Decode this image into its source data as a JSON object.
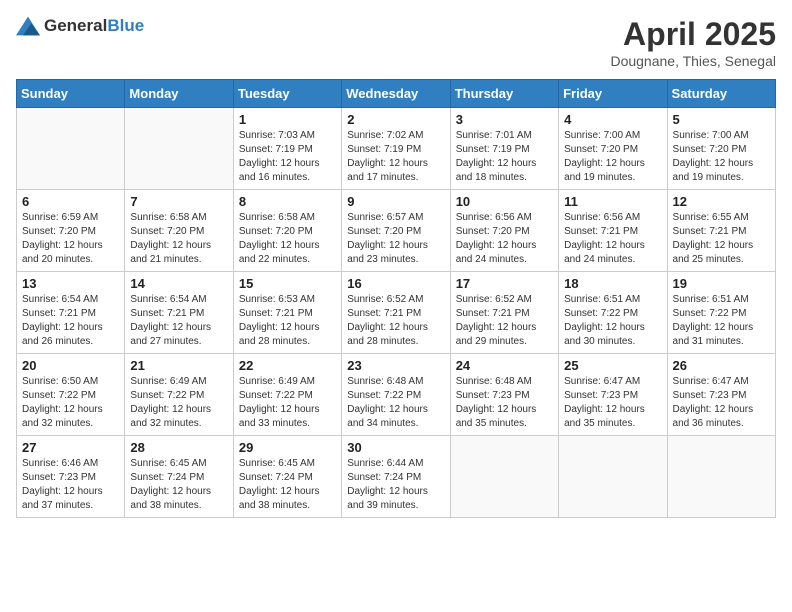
{
  "header": {
    "logo_general": "General",
    "logo_blue": "Blue",
    "month": "April 2025",
    "location": "Dougnane, Thies, Senegal"
  },
  "days_of_week": [
    "Sunday",
    "Monday",
    "Tuesday",
    "Wednesday",
    "Thursday",
    "Friday",
    "Saturday"
  ],
  "weeks": [
    [
      {
        "day": "",
        "sunrise": "",
        "sunset": "",
        "daylight": "",
        "empty": true
      },
      {
        "day": "",
        "sunrise": "",
        "sunset": "",
        "daylight": "",
        "empty": true
      },
      {
        "day": "1",
        "sunrise": "Sunrise: 7:03 AM",
        "sunset": "Sunset: 7:19 PM",
        "daylight": "Daylight: 12 hours and 16 minutes.",
        "empty": false
      },
      {
        "day": "2",
        "sunrise": "Sunrise: 7:02 AM",
        "sunset": "Sunset: 7:19 PM",
        "daylight": "Daylight: 12 hours and 17 minutes.",
        "empty": false
      },
      {
        "day": "3",
        "sunrise": "Sunrise: 7:01 AM",
        "sunset": "Sunset: 7:19 PM",
        "daylight": "Daylight: 12 hours and 18 minutes.",
        "empty": false
      },
      {
        "day": "4",
        "sunrise": "Sunrise: 7:00 AM",
        "sunset": "Sunset: 7:20 PM",
        "daylight": "Daylight: 12 hours and 19 minutes.",
        "empty": false
      },
      {
        "day": "5",
        "sunrise": "Sunrise: 7:00 AM",
        "sunset": "Sunset: 7:20 PM",
        "daylight": "Daylight: 12 hours and 19 minutes.",
        "empty": false
      }
    ],
    [
      {
        "day": "6",
        "sunrise": "Sunrise: 6:59 AM",
        "sunset": "Sunset: 7:20 PM",
        "daylight": "Daylight: 12 hours and 20 minutes.",
        "empty": false
      },
      {
        "day": "7",
        "sunrise": "Sunrise: 6:58 AM",
        "sunset": "Sunset: 7:20 PM",
        "daylight": "Daylight: 12 hours and 21 minutes.",
        "empty": false
      },
      {
        "day": "8",
        "sunrise": "Sunrise: 6:58 AM",
        "sunset": "Sunset: 7:20 PM",
        "daylight": "Daylight: 12 hours and 22 minutes.",
        "empty": false
      },
      {
        "day": "9",
        "sunrise": "Sunrise: 6:57 AM",
        "sunset": "Sunset: 7:20 PM",
        "daylight": "Daylight: 12 hours and 23 minutes.",
        "empty": false
      },
      {
        "day": "10",
        "sunrise": "Sunrise: 6:56 AM",
        "sunset": "Sunset: 7:20 PM",
        "daylight": "Daylight: 12 hours and 24 minutes.",
        "empty": false
      },
      {
        "day": "11",
        "sunrise": "Sunrise: 6:56 AM",
        "sunset": "Sunset: 7:21 PM",
        "daylight": "Daylight: 12 hours and 24 minutes.",
        "empty": false
      },
      {
        "day": "12",
        "sunrise": "Sunrise: 6:55 AM",
        "sunset": "Sunset: 7:21 PM",
        "daylight": "Daylight: 12 hours and 25 minutes.",
        "empty": false
      }
    ],
    [
      {
        "day": "13",
        "sunrise": "Sunrise: 6:54 AM",
        "sunset": "Sunset: 7:21 PM",
        "daylight": "Daylight: 12 hours and 26 minutes.",
        "empty": false
      },
      {
        "day": "14",
        "sunrise": "Sunrise: 6:54 AM",
        "sunset": "Sunset: 7:21 PM",
        "daylight": "Daylight: 12 hours and 27 minutes.",
        "empty": false
      },
      {
        "day": "15",
        "sunrise": "Sunrise: 6:53 AM",
        "sunset": "Sunset: 7:21 PM",
        "daylight": "Daylight: 12 hours and 28 minutes.",
        "empty": false
      },
      {
        "day": "16",
        "sunrise": "Sunrise: 6:52 AM",
        "sunset": "Sunset: 7:21 PM",
        "daylight": "Daylight: 12 hours and 28 minutes.",
        "empty": false
      },
      {
        "day": "17",
        "sunrise": "Sunrise: 6:52 AM",
        "sunset": "Sunset: 7:21 PM",
        "daylight": "Daylight: 12 hours and 29 minutes.",
        "empty": false
      },
      {
        "day": "18",
        "sunrise": "Sunrise: 6:51 AM",
        "sunset": "Sunset: 7:22 PM",
        "daylight": "Daylight: 12 hours and 30 minutes.",
        "empty": false
      },
      {
        "day": "19",
        "sunrise": "Sunrise: 6:51 AM",
        "sunset": "Sunset: 7:22 PM",
        "daylight": "Daylight: 12 hours and 31 minutes.",
        "empty": false
      }
    ],
    [
      {
        "day": "20",
        "sunrise": "Sunrise: 6:50 AM",
        "sunset": "Sunset: 7:22 PM",
        "daylight": "Daylight: 12 hours and 32 minutes.",
        "empty": false
      },
      {
        "day": "21",
        "sunrise": "Sunrise: 6:49 AM",
        "sunset": "Sunset: 7:22 PM",
        "daylight": "Daylight: 12 hours and 32 minutes.",
        "empty": false
      },
      {
        "day": "22",
        "sunrise": "Sunrise: 6:49 AM",
        "sunset": "Sunset: 7:22 PM",
        "daylight": "Daylight: 12 hours and 33 minutes.",
        "empty": false
      },
      {
        "day": "23",
        "sunrise": "Sunrise: 6:48 AM",
        "sunset": "Sunset: 7:22 PM",
        "daylight": "Daylight: 12 hours and 34 minutes.",
        "empty": false
      },
      {
        "day": "24",
        "sunrise": "Sunrise: 6:48 AM",
        "sunset": "Sunset: 7:23 PM",
        "daylight": "Daylight: 12 hours and 35 minutes.",
        "empty": false
      },
      {
        "day": "25",
        "sunrise": "Sunrise: 6:47 AM",
        "sunset": "Sunset: 7:23 PM",
        "daylight": "Daylight: 12 hours and 35 minutes.",
        "empty": false
      },
      {
        "day": "26",
        "sunrise": "Sunrise: 6:47 AM",
        "sunset": "Sunset: 7:23 PM",
        "daylight": "Daylight: 12 hours and 36 minutes.",
        "empty": false
      }
    ],
    [
      {
        "day": "27",
        "sunrise": "Sunrise: 6:46 AM",
        "sunset": "Sunset: 7:23 PM",
        "daylight": "Daylight: 12 hours and 37 minutes.",
        "empty": false
      },
      {
        "day": "28",
        "sunrise": "Sunrise: 6:45 AM",
        "sunset": "Sunset: 7:24 PM",
        "daylight": "Daylight: 12 hours and 38 minutes.",
        "empty": false
      },
      {
        "day": "29",
        "sunrise": "Sunrise: 6:45 AM",
        "sunset": "Sunset: 7:24 PM",
        "daylight": "Daylight: 12 hours and 38 minutes.",
        "empty": false
      },
      {
        "day": "30",
        "sunrise": "Sunrise: 6:44 AM",
        "sunset": "Sunset: 7:24 PM",
        "daylight": "Daylight: 12 hours and 39 minutes.",
        "empty": false
      },
      {
        "day": "",
        "sunrise": "",
        "sunset": "",
        "daylight": "",
        "empty": true
      },
      {
        "day": "",
        "sunrise": "",
        "sunset": "",
        "daylight": "",
        "empty": true
      },
      {
        "day": "",
        "sunrise": "",
        "sunset": "",
        "daylight": "",
        "empty": true
      }
    ]
  ]
}
